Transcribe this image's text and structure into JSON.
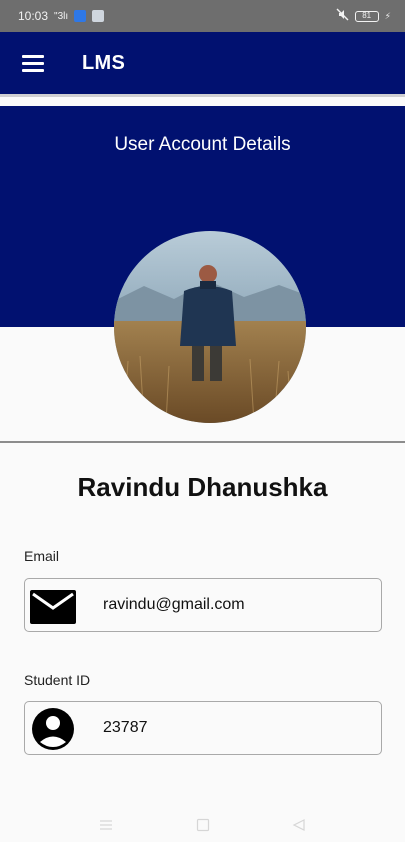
{
  "status_bar": {
    "time": "10:03",
    "signal_text": "\"3lı",
    "battery": "81"
  },
  "app_bar": {
    "title": "LMS",
    "menu_icon": "hamburger-menu-icon"
  },
  "header": {
    "title": "User Account Details"
  },
  "profile": {
    "name": "Ravindu Dhanushka"
  },
  "fields": {
    "email": {
      "label": "Email",
      "value": "ravindu@gmail.com",
      "icon": "envelope-icon"
    },
    "student_id": {
      "label": "Student ID",
      "value": "23787",
      "icon": "person-icon"
    }
  },
  "nav_bar": {
    "buttons": [
      "menu-nav-icon",
      "home-square-icon",
      "back-triangle-icon"
    ]
  },
  "colors": {
    "primary": "#011170",
    "status_bar": "#6e6e6e",
    "background": "#fafafa"
  }
}
